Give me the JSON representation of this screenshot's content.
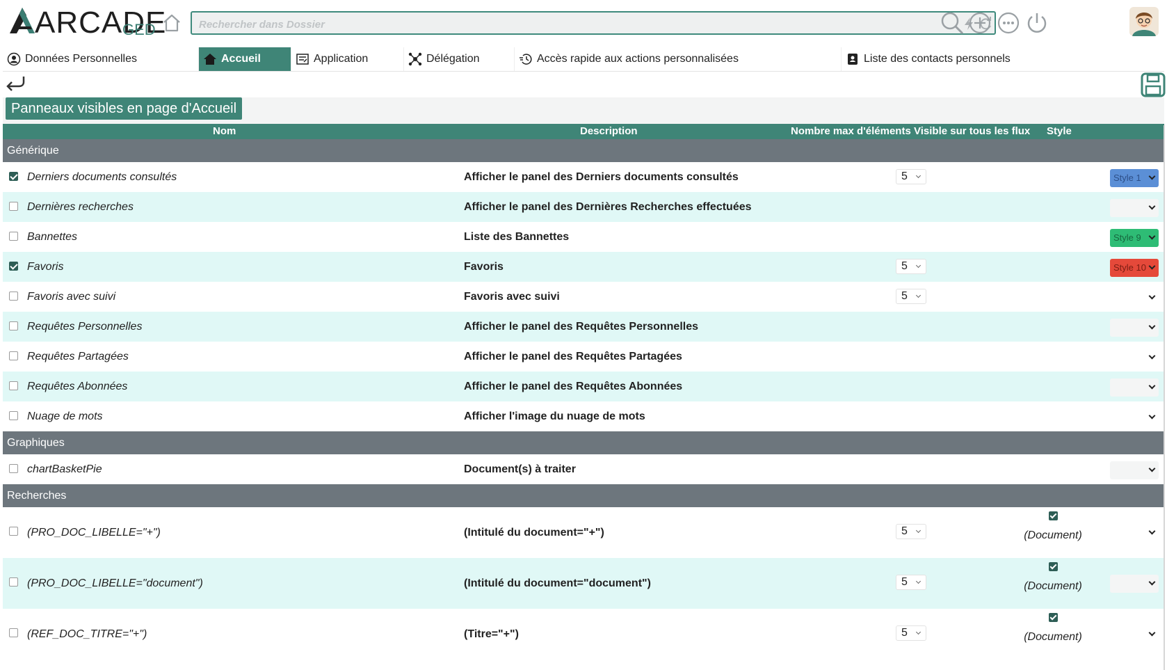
{
  "header": {
    "logo_main": "ARCADE",
    "logo_sub": "GED",
    "search_placeholder": "Rechercher dans Dossier"
  },
  "tabs": [
    {
      "label": "Données Personnelles",
      "icon": "user-circle-icon",
      "active": false
    },
    {
      "label": "Accueil",
      "icon": "home-icon",
      "active": true
    },
    {
      "label": "Application",
      "icon": "application-settings-icon",
      "active": false
    },
    {
      "label": "Délégation",
      "icon": "delegation-network-icon",
      "active": false
    },
    {
      "label": "Accès rapide aux actions personnalisées",
      "icon": "quick-actions-icon",
      "active": false
    },
    {
      "label": "Liste des contacts personnels",
      "icon": "contact-card-icon",
      "active": false
    }
  ],
  "panel": {
    "title": "Panneaux visibles en page d'Accueil"
  },
  "table": {
    "columns": [
      "Nom",
      "Description",
      "Nombre max d'éléments",
      "Visible sur tous les flux",
      "Style"
    ],
    "groups": [
      {
        "label": "Générique",
        "rows": [
          {
            "checked": true,
            "name": "Derniers documents consultés",
            "description": "Afficher le panel des Derniers documents consultés",
            "max": "5",
            "style": "Style 1",
            "style_color": "#5b8fd6",
            "style_text_color": "#2d4f88"
          },
          {
            "checked": false,
            "name": "Dernières recherches",
            "description": "Afficher le panel des Dernières Recherches effectuées",
            "max": "",
            "style": "",
            "style_kind": "empty"
          },
          {
            "checked": false,
            "name": "Bannettes",
            "description": "Liste des Bannettes",
            "max": "",
            "style": "Style 9",
            "style_color": "#2ebc75",
            "style_text_color": "#17663f"
          },
          {
            "checked": true,
            "name": "Favoris",
            "description": "Favoris",
            "max": "5",
            "style": "Style 10",
            "style_color": "#e5493a",
            "style_text_color": "#7a1d12"
          },
          {
            "checked": false,
            "name": "Favoris avec suivi",
            "description": "Favoris avec suivi",
            "max": "5",
            "style": "",
            "style_kind": "plain"
          },
          {
            "checked": false,
            "name": "Requêtes Personnelles",
            "description": "Afficher le panel des Requêtes Personnelles",
            "max": "",
            "style": "",
            "style_kind": "empty"
          },
          {
            "checked": false,
            "name": "Requêtes Partagées",
            "description": "Afficher le panel des Requêtes Partagées",
            "max": "",
            "style": "",
            "style_kind": "plain"
          },
          {
            "checked": false,
            "name": "Requêtes Abonnées",
            "description": "Afficher le panel des Requêtes Abonnées",
            "max": "",
            "style": "",
            "style_kind": "empty"
          },
          {
            "checked": false,
            "name": "Nuage de mots",
            "description": "Afficher l'image du nuage de mots",
            "max": "",
            "style": "",
            "style_kind": "plain"
          }
        ]
      },
      {
        "label": "Graphiques",
        "rows": [
          {
            "checked": false,
            "name": "chartBasketPie",
            "description": "Document(s) à traiter",
            "max": "",
            "style": "",
            "style_kind": "empty"
          }
        ]
      },
      {
        "label": "Recherches",
        "rows": [
          {
            "checked": false,
            "name": "(PRO_DOC_LIBELLE=\"+\")",
            "description": "(Intitulé du document=\"+\")",
            "max": "5",
            "visible": true,
            "visible_label": "(Document)",
            "style": "",
            "style_kind": "plain",
            "tall": true
          },
          {
            "checked": false,
            "name": "(PRO_DOC_LIBELLE=\"document\")",
            "description": "(Intitulé du document=\"document\")",
            "max": "5",
            "visible": true,
            "visible_label": "(Document)",
            "style": "",
            "style_kind": "empty",
            "tall": true
          },
          {
            "checked": false,
            "name": "(REF_DOC_TITRE=\"+\")",
            "description": "(Titre=\"+\")",
            "max": "5",
            "visible": true,
            "visible_label": "(Document)",
            "style": "",
            "style_kind": "plain",
            "tall": true
          }
        ]
      }
    ]
  },
  "colors": {
    "accent": "#3f8577",
    "group_header": "#6d767d",
    "row_alt": "#e0f8f6"
  }
}
